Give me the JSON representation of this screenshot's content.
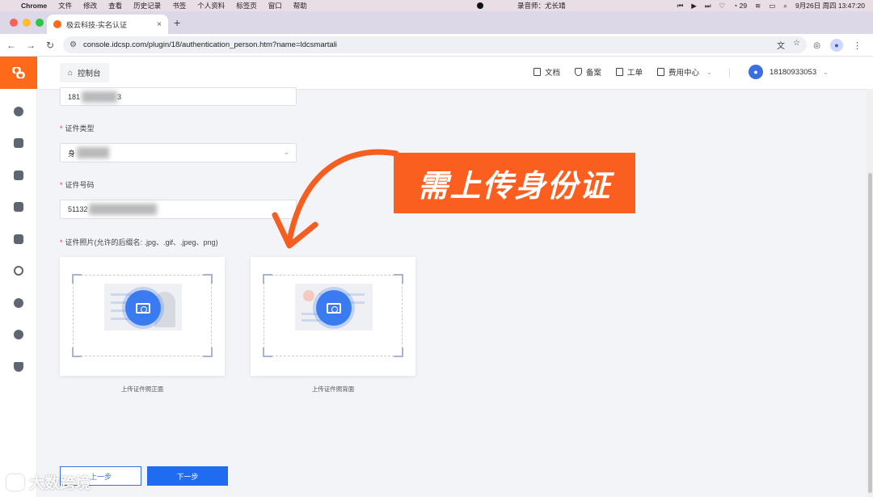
{
  "mac_menu": {
    "app": "Chrome",
    "items": [
      "文件",
      "修改",
      "查看",
      "历史记录",
      "书签",
      "个人资料",
      "标签页",
      "窗口",
      "帮助"
    ],
    "recorder": "录音师：尤长靖",
    "chat_count": "29",
    "datetime": "9月26日 周四  13:47:20"
  },
  "browser": {
    "tab_title": "极云科技-实名认证",
    "url": "console.idcsp.com/plugin/18/authentication_person.htm?name=ldcsmartali"
  },
  "header": {
    "console_label": "控制台",
    "links": [
      "文档",
      "备案",
      "工单",
      "费用中心"
    ],
    "user_phone": "18180933053"
  },
  "sidebar": {
    "icons": [
      "gear-icon",
      "server-list-icon",
      "database-icon",
      "box-icon",
      "server-settings-icon",
      "globe-icon",
      "ssl-icon",
      "compass-icon",
      "shield-check-icon"
    ]
  },
  "form": {
    "phone_prefix": "181",
    "phone_suffix": "3",
    "id_type_label": "证件类型",
    "id_type_value_prefix": "身",
    "id_number_label": "证件号码",
    "id_number_prefix": "51132",
    "id_photo_label": "证件照片(允许的后缀名: .jpg、.gif、.jpeg、png)",
    "upload_front_caption": "上传证件照正面",
    "upload_back_caption": "上传证件照背面",
    "prev_button": "上一步",
    "next_button": "下一步"
  },
  "annotation": {
    "banner_text": "需上传身份证",
    "banner_color": "#fa5f20"
  },
  "watermark": "大数跨境"
}
